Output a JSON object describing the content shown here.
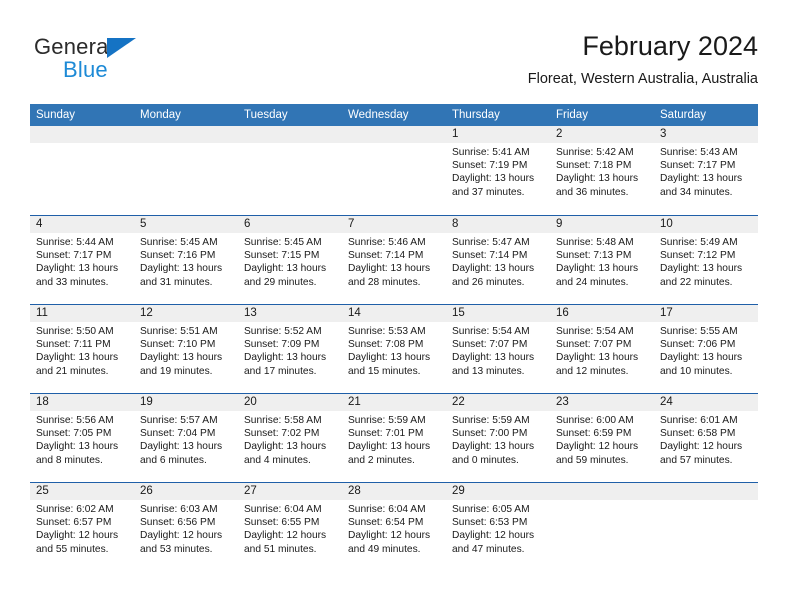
{
  "brand": {
    "name_top": "General",
    "name_bottom": "Blue",
    "triangle_icon": "brand-triangle-icon",
    "accent_color": "#1573c4",
    "blue_text_color": "#1d8ad6"
  },
  "header": {
    "title": "February 2024",
    "subtitle": "Floreat, Western Australia, Australia"
  },
  "calendar": {
    "header_bg_color": "#3175b5",
    "week_separator_color": "#1f5fa8",
    "day_band_color": "#efefef",
    "weekdays": [
      "Sunday",
      "Monday",
      "Tuesday",
      "Wednesday",
      "Thursday",
      "Friday",
      "Saturday"
    ],
    "weeks": [
      [
        {
          "day": "",
          "lines": []
        },
        {
          "day": "",
          "lines": []
        },
        {
          "day": "",
          "lines": []
        },
        {
          "day": "",
          "lines": []
        },
        {
          "day": "1",
          "lines": [
            "Sunrise: 5:41 AM",
            "Sunset: 7:19 PM",
            "Daylight: 13 hours",
            "and 37 minutes."
          ]
        },
        {
          "day": "2",
          "lines": [
            "Sunrise: 5:42 AM",
            "Sunset: 7:18 PM",
            "Daylight: 13 hours",
            "and 36 minutes."
          ]
        },
        {
          "day": "3",
          "lines": [
            "Sunrise: 5:43 AM",
            "Sunset: 7:17 PM",
            "Daylight: 13 hours",
            "and 34 minutes."
          ]
        }
      ],
      [
        {
          "day": "4",
          "lines": [
            "Sunrise: 5:44 AM",
            "Sunset: 7:17 PM",
            "Daylight: 13 hours",
            "and 33 minutes."
          ]
        },
        {
          "day": "5",
          "lines": [
            "Sunrise: 5:45 AM",
            "Sunset: 7:16 PM",
            "Daylight: 13 hours",
            "and 31 minutes."
          ]
        },
        {
          "day": "6",
          "lines": [
            "Sunrise: 5:45 AM",
            "Sunset: 7:15 PM",
            "Daylight: 13 hours",
            "and 29 minutes."
          ]
        },
        {
          "day": "7",
          "lines": [
            "Sunrise: 5:46 AM",
            "Sunset: 7:14 PM",
            "Daylight: 13 hours",
            "and 28 minutes."
          ]
        },
        {
          "day": "8",
          "lines": [
            "Sunrise: 5:47 AM",
            "Sunset: 7:14 PM",
            "Daylight: 13 hours",
            "and 26 minutes."
          ]
        },
        {
          "day": "9",
          "lines": [
            "Sunrise: 5:48 AM",
            "Sunset: 7:13 PM",
            "Daylight: 13 hours",
            "and 24 minutes."
          ]
        },
        {
          "day": "10",
          "lines": [
            "Sunrise: 5:49 AM",
            "Sunset: 7:12 PM",
            "Daylight: 13 hours",
            "and 22 minutes."
          ]
        }
      ],
      [
        {
          "day": "11",
          "lines": [
            "Sunrise: 5:50 AM",
            "Sunset: 7:11 PM",
            "Daylight: 13 hours",
            "and 21 minutes."
          ]
        },
        {
          "day": "12",
          "lines": [
            "Sunrise: 5:51 AM",
            "Sunset: 7:10 PM",
            "Daylight: 13 hours",
            "and 19 minutes."
          ]
        },
        {
          "day": "13",
          "lines": [
            "Sunrise: 5:52 AM",
            "Sunset: 7:09 PM",
            "Daylight: 13 hours",
            "and 17 minutes."
          ]
        },
        {
          "day": "14",
          "lines": [
            "Sunrise: 5:53 AM",
            "Sunset: 7:08 PM",
            "Daylight: 13 hours",
            "and 15 minutes."
          ]
        },
        {
          "day": "15",
          "lines": [
            "Sunrise: 5:54 AM",
            "Sunset: 7:07 PM",
            "Daylight: 13 hours",
            "and 13 minutes."
          ]
        },
        {
          "day": "16",
          "lines": [
            "Sunrise: 5:54 AM",
            "Sunset: 7:07 PM",
            "Daylight: 13 hours",
            "and 12 minutes."
          ]
        },
        {
          "day": "17",
          "lines": [
            "Sunrise: 5:55 AM",
            "Sunset: 7:06 PM",
            "Daylight: 13 hours",
            "and 10 minutes."
          ]
        }
      ],
      [
        {
          "day": "18",
          "lines": [
            "Sunrise: 5:56 AM",
            "Sunset: 7:05 PM",
            "Daylight: 13 hours",
            "and 8 minutes."
          ]
        },
        {
          "day": "19",
          "lines": [
            "Sunrise: 5:57 AM",
            "Sunset: 7:04 PM",
            "Daylight: 13 hours",
            "and 6 minutes."
          ]
        },
        {
          "day": "20",
          "lines": [
            "Sunrise: 5:58 AM",
            "Sunset: 7:02 PM",
            "Daylight: 13 hours",
            "and 4 minutes."
          ]
        },
        {
          "day": "21",
          "lines": [
            "Sunrise: 5:59 AM",
            "Sunset: 7:01 PM",
            "Daylight: 13 hours",
            "and 2 minutes."
          ]
        },
        {
          "day": "22",
          "lines": [
            "Sunrise: 5:59 AM",
            "Sunset: 7:00 PM",
            "Daylight: 13 hours",
            "and 0 minutes."
          ]
        },
        {
          "day": "23",
          "lines": [
            "Sunrise: 6:00 AM",
            "Sunset: 6:59 PM",
            "Daylight: 12 hours",
            "and 59 minutes."
          ]
        },
        {
          "day": "24",
          "lines": [
            "Sunrise: 6:01 AM",
            "Sunset: 6:58 PM",
            "Daylight: 12 hours",
            "and 57 minutes."
          ]
        }
      ],
      [
        {
          "day": "25",
          "lines": [
            "Sunrise: 6:02 AM",
            "Sunset: 6:57 PM",
            "Daylight: 12 hours",
            "and 55 minutes."
          ]
        },
        {
          "day": "26",
          "lines": [
            "Sunrise: 6:03 AM",
            "Sunset: 6:56 PM",
            "Daylight: 12 hours",
            "and 53 minutes."
          ]
        },
        {
          "day": "27",
          "lines": [
            "Sunrise: 6:04 AM",
            "Sunset: 6:55 PM",
            "Daylight: 12 hours",
            "and 51 minutes."
          ]
        },
        {
          "day": "28",
          "lines": [
            "Sunrise: 6:04 AM",
            "Sunset: 6:54 PM",
            "Daylight: 12 hours",
            "and 49 minutes."
          ]
        },
        {
          "day": "29",
          "lines": [
            "Sunrise: 6:05 AM",
            "Sunset: 6:53 PM",
            "Daylight: 12 hours",
            "and 47 minutes."
          ]
        },
        {
          "day": "",
          "lines": []
        },
        {
          "day": "",
          "lines": []
        }
      ]
    ]
  }
}
